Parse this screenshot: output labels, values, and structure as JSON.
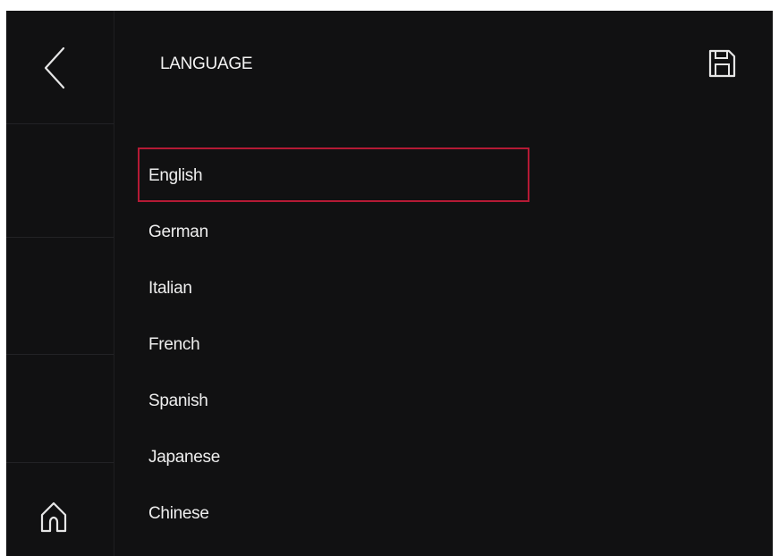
{
  "header": {
    "title": "LANGUAGE",
    "back_icon": "chevron-left-icon",
    "save_icon": "save-icon"
  },
  "sidebar": {
    "home_icon": "home-icon"
  },
  "languages": {
    "selected": "English",
    "items": [
      {
        "label": "English"
      },
      {
        "label": "German"
      },
      {
        "label": "Italian"
      },
      {
        "label": "French"
      },
      {
        "label": "Spanish"
      },
      {
        "label": "Japanese"
      },
      {
        "label": "Chinese"
      }
    ]
  },
  "colors": {
    "background": "#111112",
    "text": "#eeeeee",
    "selection_border": "#b51a35",
    "divider": "#222225"
  }
}
